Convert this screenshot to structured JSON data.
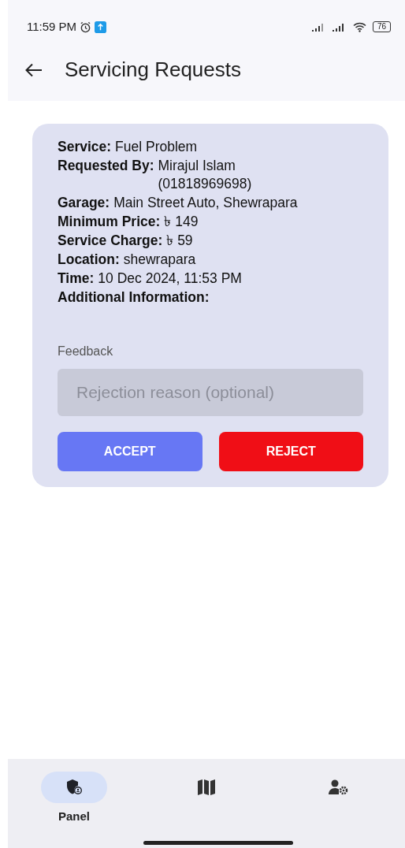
{
  "status_bar": {
    "time": "11:59 PM",
    "battery": "76"
  },
  "app_bar": {
    "title": "Servicing Requests"
  },
  "request": {
    "details": [
      {
        "label": "Service:",
        "value": "Fuel Problem"
      },
      {
        "label": "Requested By:",
        "value": "Mirajul Islam\n(01818969698)"
      },
      {
        "label": "Garage:",
        "value": "Main Street Auto, Shewrapara"
      },
      {
        "label": "Minimum Price:",
        "value": "৳ 149"
      },
      {
        "label": "Service Charge:",
        "value": "৳ 59"
      },
      {
        "label": "Location:",
        "value": "shewrapara"
      },
      {
        "label": "Time:",
        "value": "10 Dec 2024, 11:53 PM"
      },
      {
        "label": "Additional Information:"
      }
    ],
    "feedback": {
      "label": "Feedback",
      "placeholder": "Rejection reason (optional)"
    },
    "buttons": [
      {
        "label": "ACCEPT",
        "kind": "accept"
      },
      {
        "label": "REJECT",
        "kind": "reject"
      }
    ]
  },
  "bottom_nav": [
    {
      "kind": "shield",
      "label": "Panel",
      "selected": true
    },
    {
      "kind": "map",
      "selected": false
    },
    {
      "kind": "usergear",
      "selected": false
    }
  ]
}
